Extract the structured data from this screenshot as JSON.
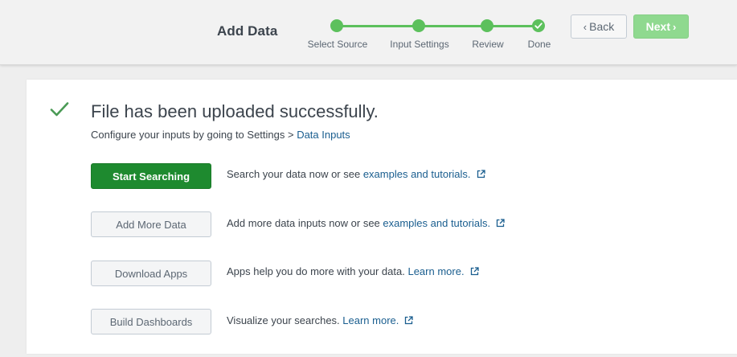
{
  "header": {
    "title": "Add Data",
    "back_label": "Back",
    "next_label": "Next",
    "steps": [
      {
        "label": "Select Source",
        "state": "complete"
      },
      {
        "label": "Input Settings",
        "state": "complete"
      },
      {
        "label": "Review",
        "state": "complete"
      },
      {
        "label": "Done",
        "state": "done"
      }
    ]
  },
  "main": {
    "title": "File has been uploaded successfully.",
    "subtitle_prefix": "Configure your inputs by going to Settings > ",
    "subtitle_link": "Data Inputs",
    "actions": [
      {
        "button": "Start Searching",
        "text": "Search your data now or see ",
        "link": "examples and tutorials.",
        "icon": "external-link-icon"
      },
      {
        "button": "Add More Data",
        "text": "Add more data inputs now or see ",
        "link": "examples and tutorials.",
        "icon": "external-link-icon"
      },
      {
        "button": "Download Apps",
        "text": "Apps help you do more with your data. ",
        "link": "Learn more.",
        "icon": "external-link-icon"
      },
      {
        "button": "Build Dashboards",
        "text": "Visualize your searches. ",
        "link": "Learn more.",
        "icon": "external-link-icon"
      }
    ]
  },
  "colors": {
    "accent_green": "#5cc05c",
    "primary_button": "#1e8a2f",
    "next_disabled": "#8fd98f",
    "link": "#1a5e8f",
    "check": "#4a9a55"
  }
}
